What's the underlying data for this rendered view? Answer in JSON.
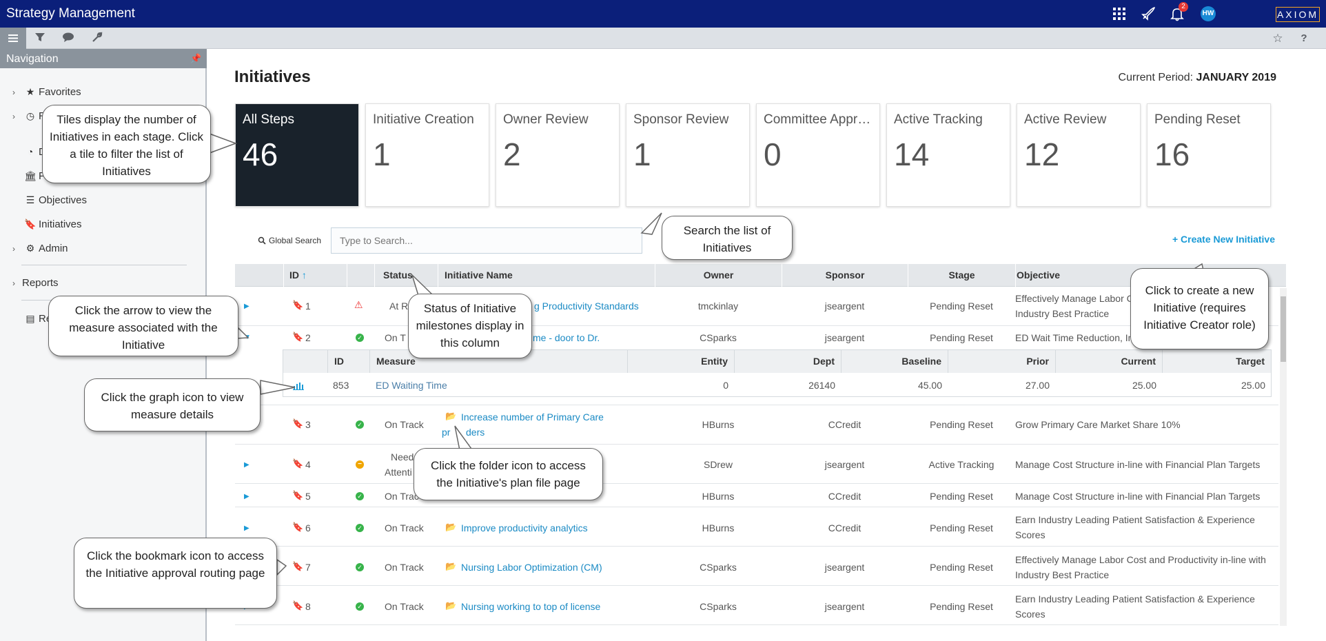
{
  "header": {
    "app_title": "Strategy Management",
    "notification_count": "2",
    "avatar_initials": "HW",
    "brand": "AXIOM"
  },
  "navigation": {
    "title": "Navigation",
    "items": [
      {
        "label": "Favorites"
      },
      {
        "label": "Re"
      },
      {
        "label": "D"
      },
      {
        "label": "Pe"
      },
      {
        "label": "Objectives"
      },
      {
        "label": "Initiatives"
      },
      {
        "label": "Admin"
      },
      {
        "label": "Reports"
      },
      {
        "label": "Re"
      }
    ]
  },
  "page": {
    "title": "Initiatives",
    "period_label": "Current Period:",
    "period_value": "JANUARY 2019"
  },
  "tiles": [
    {
      "label": "All Steps",
      "count": "46"
    },
    {
      "label": "Initiative Creation",
      "count": "1"
    },
    {
      "label": "Owner Review",
      "count": "2"
    },
    {
      "label": "Sponsor Review",
      "count": "1"
    },
    {
      "label": "Committee Appro...",
      "count": "0"
    },
    {
      "label": "Active Tracking",
      "count": "14"
    },
    {
      "label": "Active Review",
      "count": "12"
    },
    {
      "label": "Pending Reset",
      "count": "16"
    }
  ],
  "search": {
    "label": "Global Search",
    "placeholder": "Type to Search..."
  },
  "create_label": "+ Create New Initiative",
  "table": {
    "columns": [
      "ID",
      "Status",
      "Initiative Name",
      "Owner",
      "Sponsor",
      "Stage",
      "Objective"
    ],
    "rows": [
      {
        "id": "1",
        "status": "At R",
        "name": "g Productivity Standards",
        "owner": "tmckinlay",
        "sponsor": "jseargent",
        "stage": "Pending Reset",
        "objective": "Effectively Manage Labor C",
        "objective2": "Industry Best Practice"
      },
      {
        "id": "2",
        "status": "On T",
        "name": "me - door to Dr.",
        "owner": "CSparks",
        "sponsor": "jseargent",
        "stage": "Pending Reset",
        "objective": "ED Wait Time Reduction, In",
        "objective2": ""
      },
      {
        "id": "3",
        "status": "On Track",
        "name": "Increase number of Primary Care",
        "name2": "pr",
        "name3": "ders",
        "owner": "HBurns",
        "sponsor": "CCredit",
        "stage": "Pending Reset",
        "objective": "Grow Primary Care Market Share 10%",
        "objective2": ""
      },
      {
        "id": "4",
        "status": "Need",
        "status2": "Attenti",
        "name": "",
        "owner": "SDrew",
        "sponsor": "jseargent",
        "stage": "Active Tracking",
        "objective": "Manage Cost Structure in-line with Financial Plan Targets",
        "objective2": ""
      },
      {
        "id": "5",
        "status": "On Trac",
        "name": "",
        "owner": "HBurns",
        "sponsor": "CCredit",
        "stage": "Pending Reset",
        "objective": "Manage Cost Structure in-line with Financial Plan Targets",
        "objective2": ""
      },
      {
        "id": "6",
        "status": "On Track",
        "name": "Improve productivity analytics",
        "owner": "HBurns",
        "sponsor": "CCredit",
        "stage": "Pending Reset",
        "objective": "Earn Industry Leading Patient Satisfaction & Experience",
        "objective2": "Scores"
      },
      {
        "id": "7",
        "status": "On Track",
        "name": "Nursing Labor Optimization (CM)",
        "owner": "CSparks",
        "sponsor": "jseargent",
        "stage": "Pending Reset",
        "objective": "Effectively Manage Labor Cost and Productivity in-line with",
        "objective2": "Industry Best Practice"
      },
      {
        "id": "8",
        "status": "On Track",
        "name": "Nursing working to top of license",
        "owner": "CSparks",
        "sponsor": "jseargent",
        "stage": "Pending Reset",
        "objective": "Earn Industry Leading Patient Satisfaction & Experience",
        "objective2": "Scores"
      }
    ]
  },
  "subtable": {
    "columns": [
      "ID",
      "Measure",
      "Entity",
      "Dept",
      "Baseline",
      "Prior",
      "Current",
      "Target"
    ],
    "row": {
      "id": "853",
      "measure": "ED Waiting Time",
      "entity": "0",
      "dept": "26140",
      "baseline": "45.00",
      "prior": "27.00",
      "current": "25.00",
      "target": "25.00"
    }
  },
  "callouts": {
    "tiles": "Tiles display the number of Initiatives in each stage. Click a tile to filter the list of Initiatives",
    "search": "Search the list of Initiatives",
    "create": "Click to create a new Initiative (requires Initiative Creator role)",
    "arrow": "Click the arrow to view the measure associated with the Initiative",
    "status": "Status of Initiative milestones display in this column",
    "graph": "Click the graph icon to view measure details",
    "folder": "Click the folder icon to access the Initiative's plan file page",
    "bookmark": "Click the bookmark icon to access the Initiative approval routing page"
  },
  "colors": {
    "header_bg": "#0b1f7a",
    "accent": "#1a9ad6",
    "selected_tile": "#19222b",
    "ok": "#37b34a",
    "warn": "#e33333",
    "attention": "#f0a500"
  }
}
